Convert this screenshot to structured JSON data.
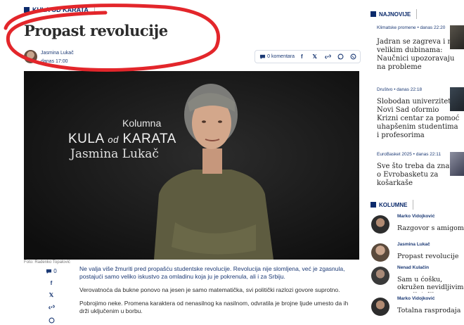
{
  "article": {
    "kicker": "KULA OD KARATA",
    "title": "Propast revolucije",
    "author": "Jasmina Lukač",
    "date": "danas 17:00",
    "comments_label": "0 komentara",
    "hero": {
      "kolumna": "Kolumna",
      "brand_kula": "KULA",
      "brand_od": "od",
      "brand_karata": "KARATA",
      "name": "Jasmina Lukač"
    },
    "photo_credit": "Foto: Radenko Topalović",
    "side_comments_count": "0",
    "paragraphs": [
      "Ne valja više žmuriti pred propašću studentske revolucije. Revolucija nije slomljena, već je zgasnula, postajući samo veliko iskustvo za omladinu koja ju je pokrenula, ali i za Srbiju.",
      "Verovatnoća da bukne ponovo na jesen je samo matematička, svi politički razlozi govore suprotno.",
      "Pobrojimo neke. Promena karaktera od nenasilnog ka nasilnom, odvratila je brojne ljude umesto da ih drži uključenim u borbu."
    ]
  },
  "sidebar": {
    "latest_heading": "NAJNOVIJE",
    "latest": [
      {
        "meta": "Klimatske promene • danas 22:20",
        "headline": "Jadran se zagreva i na velikim dubinama: Naučnici upozoravaju na probleme"
      },
      {
        "meta": "Društvo • danas 22:18",
        "headline": "Slobodan univerzitet Novi Sad oformio Krizni centar za pomoć uhapšenim studentima i profesorima"
      },
      {
        "meta": "EuroBasket 2025 • danas 22:11",
        "headline": "Sve što treba da znate o Evrobasketu za košarkaše"
      }
    ],
    "columns_heading": "KOLUMNE",
    "columns": [
      {
        "author": "Marko Vidojković",
        "title": "Razgovor s amigom"
      },
      {
        "author": "Jasmina Lukač",
        "title": "Propast revolucije"
      },
      {
        "author": "Nenad Kulačin",
        "title": "Sam u ćošku, okružen nevidljivim neprijateljima"
      },
      {
        "author": "Marko Vidojković",
        "title": "Totalna rasprodaja"
      }
    ]
  },
  "colors": {
    "brand_blue": "#0b2a6b",
    "annotation_red": "#e3262b"
  },
  "icons": [
    "comment-icon",
    "facebook-icon",
    "x-icon",
    "link-icon",
    "whatsapp-icon",
    "viber-icon"
  ]
}
